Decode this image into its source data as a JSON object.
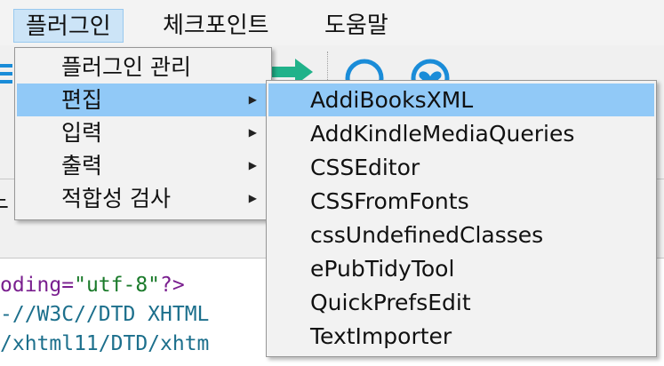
{
  "menubar": {
    "items": [
      {
        "label": "플러그인",
        "active": true
      },
      {
        "label": "체크포인트",
        "active": false
      },
      {
        "label": "도움말",
        "active": false
      }
    ]
  },
  "toolbar": {
    "icons": [
      "list-icon",
      "arrow-right-icon",
      "circle-icon",
      "heart-circle-icon"
    ],
    "accent_color": "#1a8cd8",
    "arrow_color": "#20b28a"
  },
  "left_edge_char": "느",
  "plugin_menu": {
    "items": [
      {
        "label": "플러그인 관리",
        "has_submenu": false
      },
      {
        "label": "편집",
        "has_submenu": true,
        "highlighted": true
      },
      {
        "label": "입력",
        "has_submenu": true
      },
      {
        "label": "출력",
        "has_submenu": true
      },
      {
        "label": "적합성 검사",
        "has_submenu": true
      }
    ]
  },
  "edit_submenu": {
    "items": [
      {
        "label": "AddiBooksXML",
        "highlighted": true
      },
      {
        "label": "AddKindleMediaQueries"
      },
      {
        "label": "CSSEditor"
      },
      {
        "label": "CSSFromFonts"
      },
      {
        "label": "cssUndefinedClasses"
      },
      {
        "label": "ePubTidyTool"
      },
      {
        "label": "QuickPrefsEdit"
      },
      {
        "label": "TextImporter"
      }
    ]
  },
  "code": {
    "line1": {
      "a": "oding=",
      "b": "\"utf-8\"",
      "c": "?>"
    },
    "line2": "-//W3C//DTD XHTML",
    "line3": "/xhtml11/DTD/xhtm"
  },
  "colors": {
    "highlight": "#91c9f7",
    "menubar_active": "#cce4f7"
  }
}
